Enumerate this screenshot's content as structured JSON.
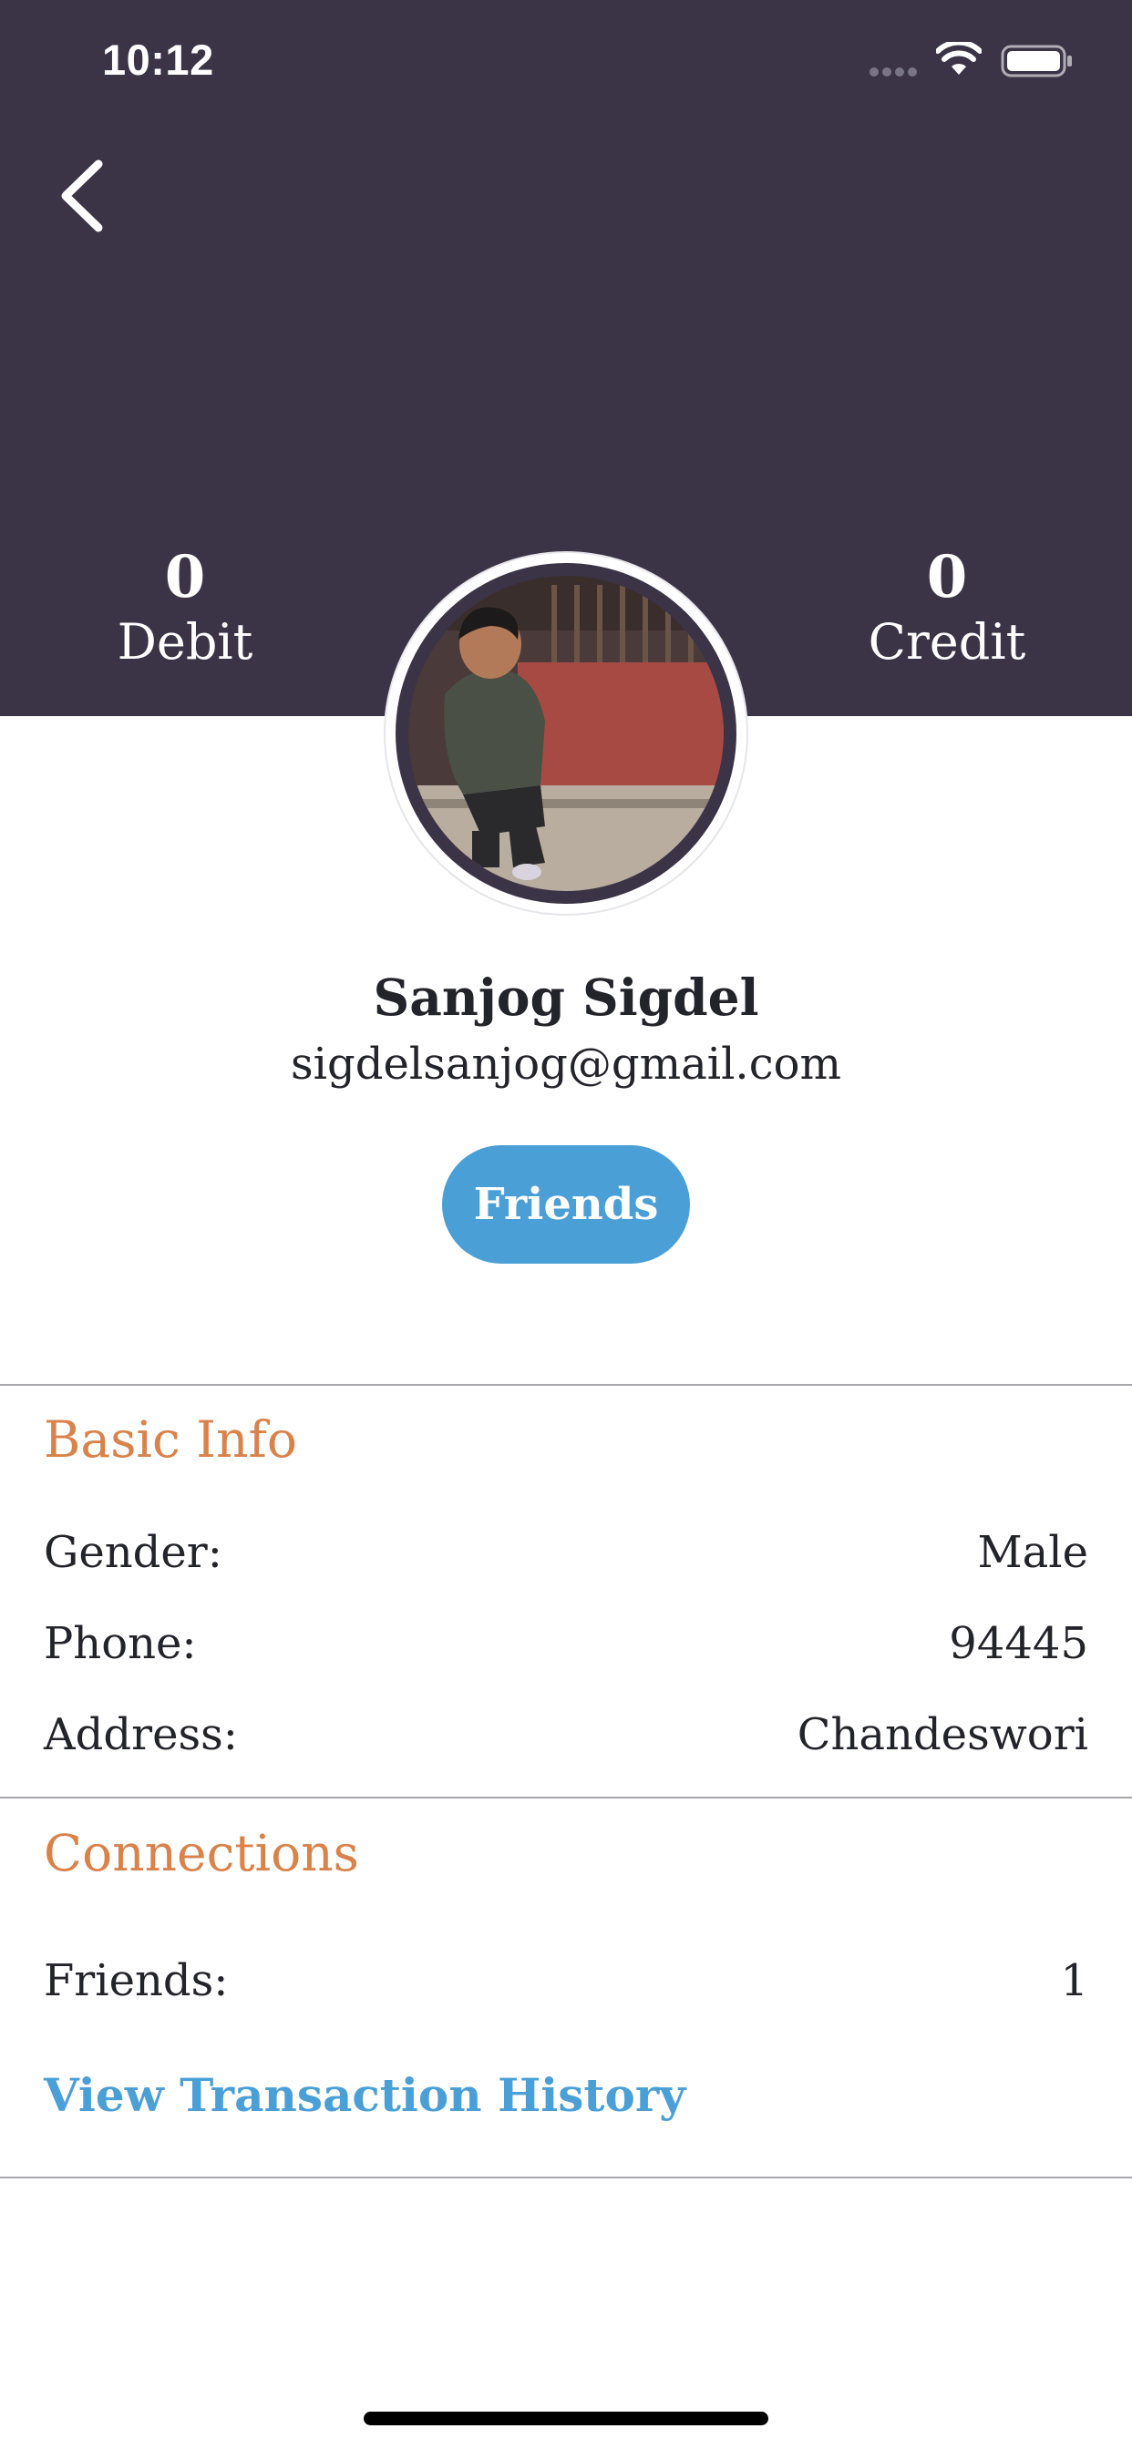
{
  "status_bar": {
    "time": "10:12"
  },
  "stats": {
    "debit": {
      "value": "0",
      "label": "Debit"
    },
    "credit": {
      "value": "0",
      "label": "Credit"
    }
  },
  "profile": {
    "name": "Sanjog Sigdel",
    "email": "sigdelsanjog@gmail.com",
    "friends_button": "Friends"
  },
  "basic_info": {
    "title": "Basic Info",
    "rows": [
      {
        "label": "Gender:",
        "value": "Male"
      },
      {
        "label": "Phone:",
        "value": "94445"
      },
      {
        "label": "Address:",
        "value": "Chandeswori"
      }
    ]
  },
  "connections": {
    "title": "Connections",
    "rows": [
      {
        "label": "Friends:",
        "value": "1"
      }
    ],
    "link": "View Transaction History"
  },
  "colors": {
    "header": "#3b3346",
    "accent_orange": "#d9824a",
    "accent_blue": "#4a9fd6"
  },
  "icons": [
    "back-chevron-icon",
    "cellular-signal-icon",
    "wifi-icon",
    "battery-icon"
  ]
}
